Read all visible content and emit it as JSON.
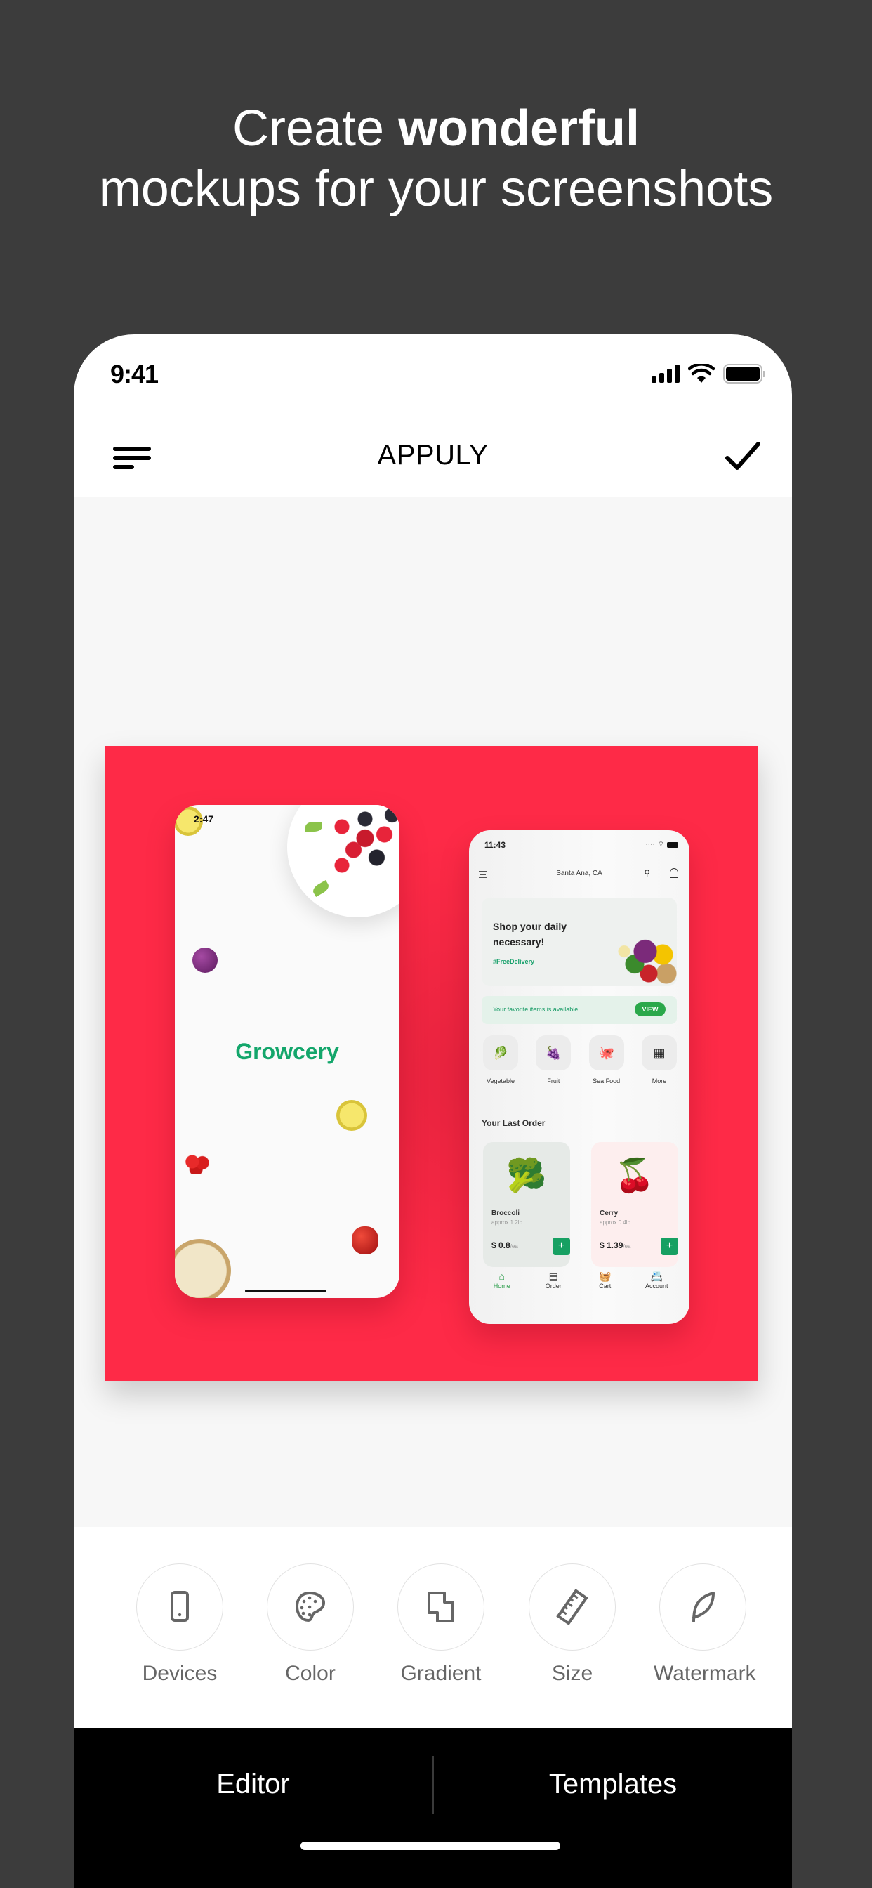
{
  "headline": {
    "line1_regular": "Create ",
    "line1_bold": "wonderful",
    "line2": "mockups for your screenshots"
  },
  "status_bar": {
    "time": "9:41"
  },
  "nav": {
    "title": "APPULY",
    "menu_icon": "menu-icon",
    "confirm_icon": "checkmark-icon"
  },
  "canvas": {
    "background_color": "#fe2a47",
    "mock_left": {
      "time": "2:47",
      "title": "Growcery",
      "title_color": "#13a66b"
    },
    "mock_right": {
      "time": "11:43",
      "location": "Santa Ana, CA",
      "banner": {
        "title": "Shop your daily necessary!",
        "tag": "#FreeDelivery"
      },
      "favorite": {
        "text": "Your favorite items is available",
        "button": "VIEW"
      },
      "categories": [
        {
          "label": "Vegetable",
          "icon": "🥬"
        },
        {
          "label": "Fruit",
          "icon": "🍇"
        },
        {
          "label": "Sea Food",
          "icon": "🐙"
        },
        {
          "label": "More",
          "icon": "▦"
        }
      ],
      "last_order_title": "Your Last Order",
      "products": [
        {
          "name": "Broccoli",
          "weight": "approx 1.2lb",
          "price": "$ 0.8",
          "unit": "/ea",
          "icon": "🥦"
        },
        {
          "name": "Cerry",
          "weight": "approx 0.4lb",
          "price": "$ 1.39",
          "unit": "/ea",
          "icon": "🍒"
        }
      ],
      "tabs": [
        {
          "label": "Home",
          "icon": "⌂"
        },
        {
          "label": "Order",
          "icon": "▤"
        },
        {
          "label": "Cart",
          "icon": "🧺"
        },
        {
          "label": "Account",
          "icon": "📇"
        }
      ]
    }
  },
  "toolbar": {
    "tools": [
      {
        "label": "Devices",
        "icon": "phone-icon"
      },
      {
        "label": "Color",
        "icon": "palette-icon"
      },
      {
        "label": "Gradient",
        "icon": "gradient-icon"
      },
      {
        "label": "Size",
        "icon": "ruler-icon"
      },
      {
        "label": "Watermark",
        "icon": "leaf-icon"
      }
    ]
  },
  "bottom_tabs": {
    "editor": "Editor",
    "templates": "Templates"
  }
}
